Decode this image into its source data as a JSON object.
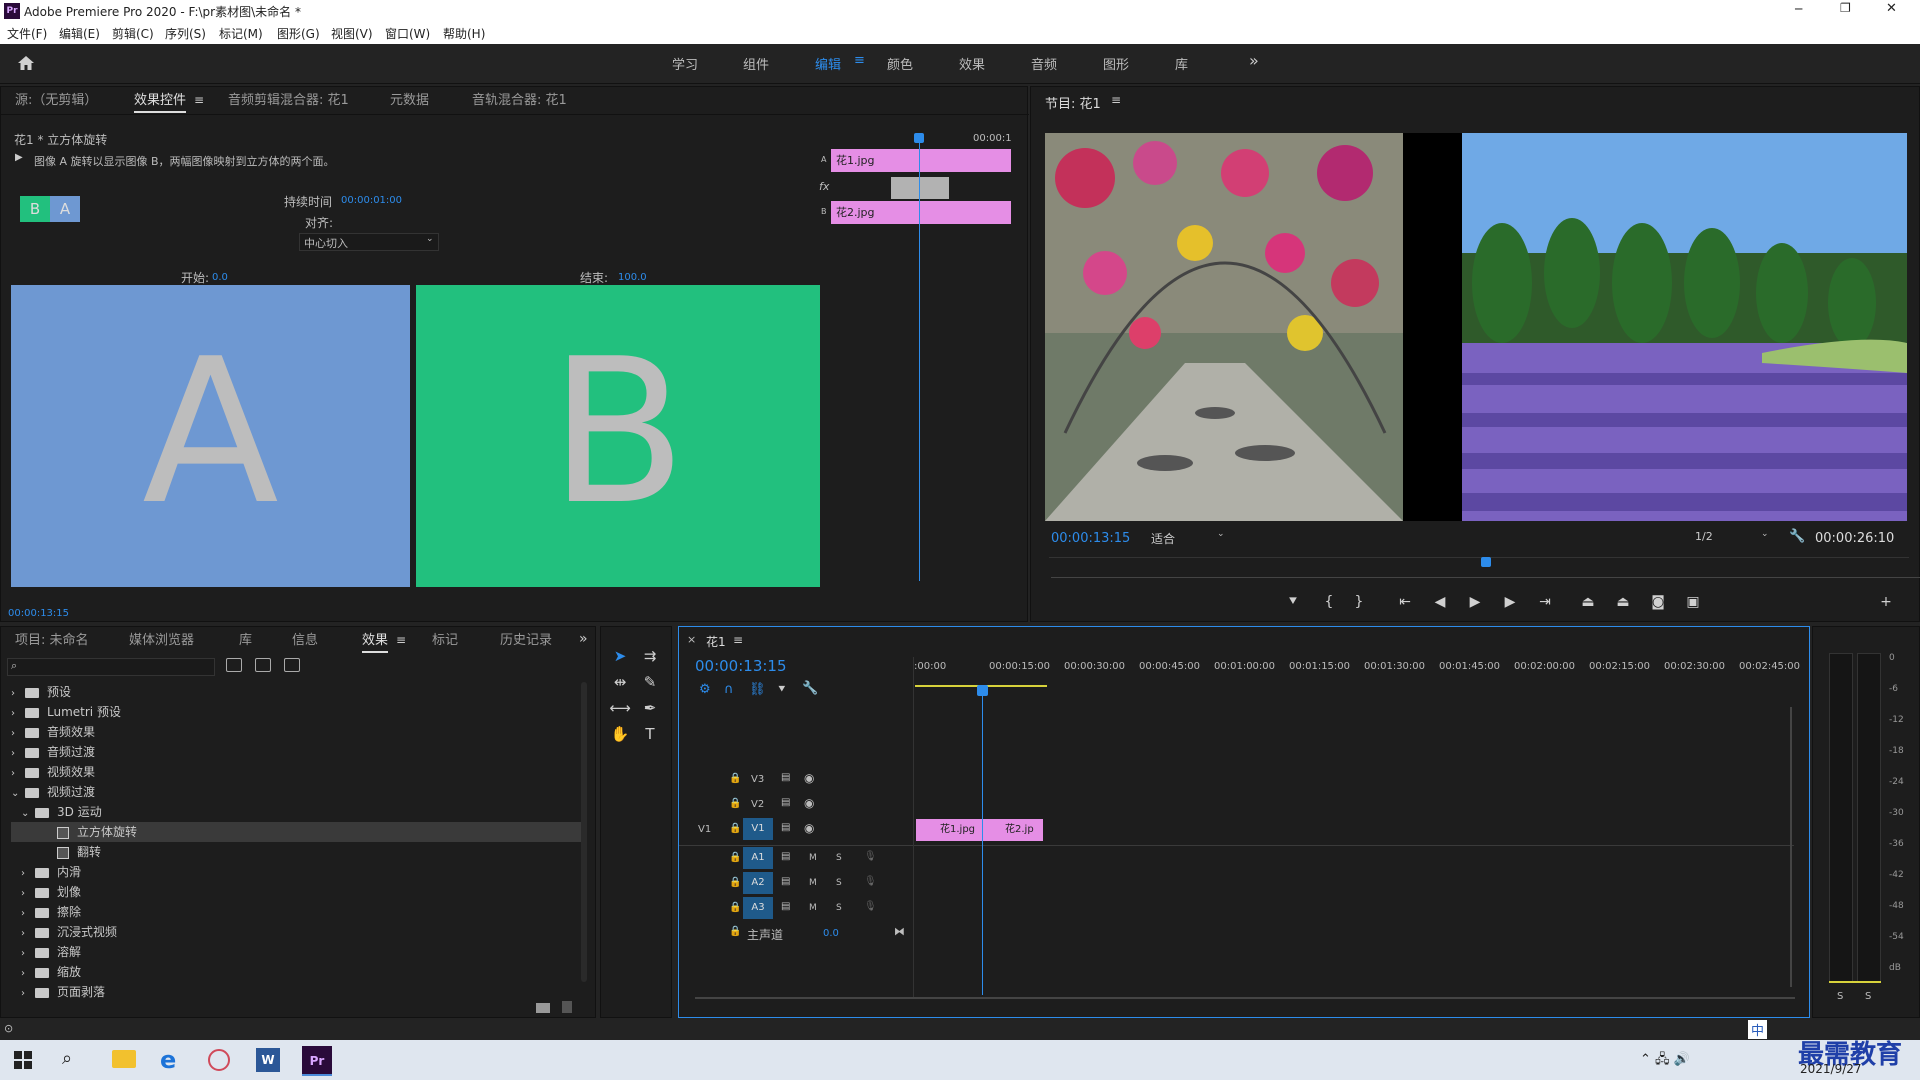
{
  "app": {
    "title": "Adobe Premiere Pro 2020 - F:\\pr素材图\\未命名 *",
    "icon_text": "Pr",
    "win_minimize": "─",
    "win_restore": "❐",
    "win_close": "✕"
  },
  "menu": [
    "文件(F)",
    "编辑(E)",
    "剪辑(C)",
    "序列(S)",
    "标记(M)",
    "图形(G)",
    "视图(V)",
    "窗口(W)",
    "帮助(H)"
  ],
  "workspaces": [
    "学习",
    "组件",
    "编辑",
    "颜色",
    "效果",
    "音频",
    "图形",
    "库"
  ],
  "workspace_menu": "≡",
  "more": "»",
  "source_tabs": [
    "源:（无剪辑）",
    "效果控件",
    "音频剪辑混合器: 花1",
    "元数据",
    "音轨混合器: 花1"
  ],
  "effect_controls": {
    "clip": "花1 * 立方体旋转",
    "description": "图像 A 旋转以显示图像 B，两幅图像映射到立方体的两个面。",
    "duration_label": "持续时间",
    "duration": "00:00:01:00",
    "align_label": "对齐:",
    "align_value": "中心切入",
    "start_label": "开始:",
    "start_value": "0.0",
    "end_label": "结束:",
    "end_value": "100.0",
    "preview_a": "A",
    "preview_b": "B",
    "thumb_b": "B",
    "thumb_a": "A",
    "timecode": "00:00:13:15",
    "mini_time": "00:00:1",
    "clip_a": "花1.jpg",
    "clip_b": "花2.jpg",
    "row_a": "A",
    "row_b": "B",
    "fx": "fx"
  },
  "program": {
    "title": "节目: 花1",
    "timecode": "00:00:13:15",
    "fit": "适合",
    "resolution": "1/2",
    "duration": "00:00:26:10"
  },
  "project_tabs": [
    "项目: 未命名",
    "媒体浏览器",
    "库",
    "信息",
    "效果",
    "标记",
    "历史记录"
  ],
  "effects_tree": [
    {
      "label": "预设",
      "level": 0,
      "type": "folder"
    },
    {
      "label": "Lumetri 预设",
      "level": 0,
      "type": "folder"
    },
    {
      "label": "音频效果",
      "level": 0,
      "type": "folder"
    },
    {
      "label": "音频过渡",
      "level": 0,
      "type": "folder"
    },
    {
      "label": "视频效果",
      "level": 0,
      "type": "folder"
    },
    {
      "label": "视频过渡",
      "level": 0,
      "type": "folder",
      "open": true
    },
    {
      "label": "3D 运动",
      "level": 1,
      "type": "folder",
      "open": true
    },
    {
      "label": "立方体旋转",
      "level": 2,
      "type": "fx",
      "selected": true
    },
    {
      "label": "翻转",
      "level": 2,
      "type": "fx"
    },
    {
      "label": "内滑",
      "level": 1,
      "type": "folder"
    },
    {
      "label": "划像",
      "level": 1,
      "type": "folder"
    },
    {
      "label": "擦除",
      "level": 1,
      "type": "folder"
    },
    {
      "label": "沉浸式视频",
      "level": 1,
      "type": "folder"
    },
    {
      "label": "溶解",
      "level": 1,
      "type": "folder"
    },
    {
      "label": "缩放",
      "level": 1,
      "type": "folder"
    },
    {
      "label": "页面剥落",
      "level": 1,
      "type": "folder"
    }
  ],
  "timeline": {
    "tab": "花1",
    "close": "×",
    "timecode": "00:00:13:15",
    "ruler": [
      ":00:00",
      "00:00:15:00",
      "00:00:30:00",
      "00:00:45:00",
      "00:01:00:00",
      "00:01:15:00",
      "00:01:30:00",
      "00:01:45:00",
      "00:02:00:00",
      "00:02:15:00",
      "00:02:30:00",
      "00:02:45:00"
    ],
    "video_tracks": [
      "V3",
      "V2",
      "V1"
    ],
    "audio_tracks": [
      "A1",
      "A2",
      "A3"
    ],
    "src_patch": "V1",
    "m": "M",
    "s": "S",
    "master": "主声道",
    "master_val": "0.0",
    "clip1": "花1.jpg",
    "clip2": "花2.jp"
  },
  "meter": {
    "labels": [
      "0",
      "-6",
      "-12",
      "-18",
      "-24",
      "-30",
      "-36",
      "-42",
      "-48",
      "-54",
      "dB"
    ],
    "solo": [
      "S",
      "S"
    ]
  },
  "taskbar": {
    "date": "2021/9/27",
    "ime": "中",
    "brand": "最需教育"
  }
}
